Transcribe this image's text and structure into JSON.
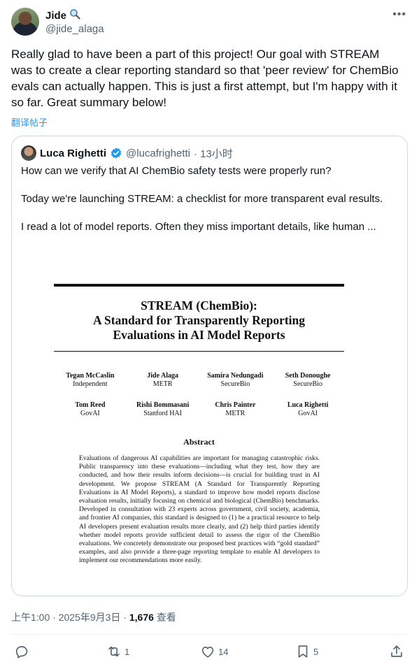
{
  "author": {
    "name": "Jide",
    "handle": "@jide_alaga",
    "name_emoji_icon": "magnifier-icon"
  },
  "tweet": {
    "text": "Really glad to have been a part of this project! Our goal with STREAM was to create a clear reporting standard so that 'peer review' for ChemBio evals can actually happen. This is just a first attempt, but I'm happy with it so far. Great summary below!",
    "translate_label": "翻译帖子"
  },
  "quote": {
    "name": "Luca Righetti",
    "handle": "@lucafrighetti",
    "time": "· 13小时",
    "lines": [
      "How can we verify that AI ChemBio safety tests were properly run?",
      "Today we're launching STREAM: a checklist for more transparent eval results.",
      "I read a lot of model reports. Often they miss important details, like human ..."
    ],
    "verified_color": "#1d9bf0"
  },
  "paper": {
    "title_line1": "STREAM (ChemBio):",
    "title_line2": "A Standard for Transparently Reporting",
    "title_line3": "Evaluations in AI Model Reports",
    "authors": [
      {
        "name": "Tegan McCaslin",
        "affil": "Independent"
      },
      {
        "name": "Jide Alaga",
        "affil": "METR"
      },
      {
        "name": "Samira Nedungadi",
        "affil": "SecureBio"
      },
      {
        "name": "Seth Donoughe",
        "affil": "SecureBio"
      },
      {
        "name": "Tom Reed",
        "affil": "GovAI"
      },
      {
        "name": "Rishi Bommasani",
        "affil": "Stanford HAI"
      },
      {
        "name": "Chris Painter",
        "affil": "METR"
      },
      {
        "name": "Luca Righetti",
        "affil": "GovAI"
      }
    ],
    "abstract_title": "Abstract",
    "abstract": "Evaluations of dangerous AI capabilities are important for managing catastrophic risks. Public transparency into these evaluations—including what they test, how they are conducted, and how their results inform decisions—is crucial for building trust in AI development. We propose STREAM (A Standard for Transparently Reporting Evaluations in AI Model Reports), a standard to improve how model reports disclose evaluation results, initially focusing on chemical and biological (ChemBio) benchmarks. Developed in consultation with 23 experts across government, civil society, academia, and frontier AI companies, this standard is designed to (1) be a practical resource to help AI developers present evaluation results more clearly, and (2) help third parties identify whether model reports provide sufficient detail to assess the rigor of the ChemBio evaluations. We concretely demonstrate our proposed best practices with “gold standard” examples, and also provide a three-page reporting template to enable AI developers to implement our recommendations more easily."
  },
  "meta": {
    "time": "上午1:00 · 2025年9月3日 · ",
    "views_count": "1,676",
    "views_label": " 查看"
  },
  "actions": {
    "reply_count": "",
    "retweet_count": "1",
    "like_count": "14",
    "bookmark_count": "5"
  },
  "colors": {
    "text_secondary": "#536471",
    "link": "#1d9bf0",
    "border": "#cfd9de"
  }
}
